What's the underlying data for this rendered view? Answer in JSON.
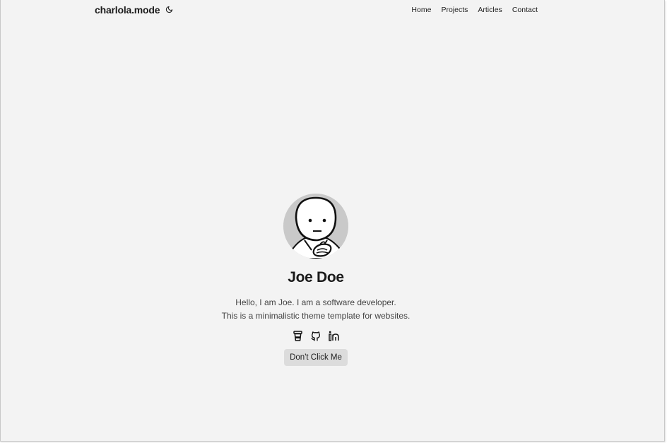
{
  "header": {
    "brand": "charlola.mode",
    "theme_toggle_icon": "moon-icon",
    "nav": [
      {
        "label": "Home"
      },
      {
        "label": "Projects"
      },
      {
        "label": "Articles"
      },
      {
        "label": "Contact"
      }
    ]
  },
  "profile": {
    "avatar_icon": "cartoon-face-avatar",
    "name": "Joe Doe",
    "bio_line_1": "Hello, I am Joe. I am a software developer.",
    "bio_line_2": "This is a minimalistic theme template for websites.",
    "social_icons": [
      "coffee-cup-icon",
      "github-icon",
      "linkedin-icon"
    ],
    "button_label": "Don't Click Me"
  },
  "colors": {
    "background": "#f3f3f3",
    "button_bg": "#dcdcdc",
    "text_primary": "#1a1a1a",
    "text_secondary": "#444444"
  }
}
